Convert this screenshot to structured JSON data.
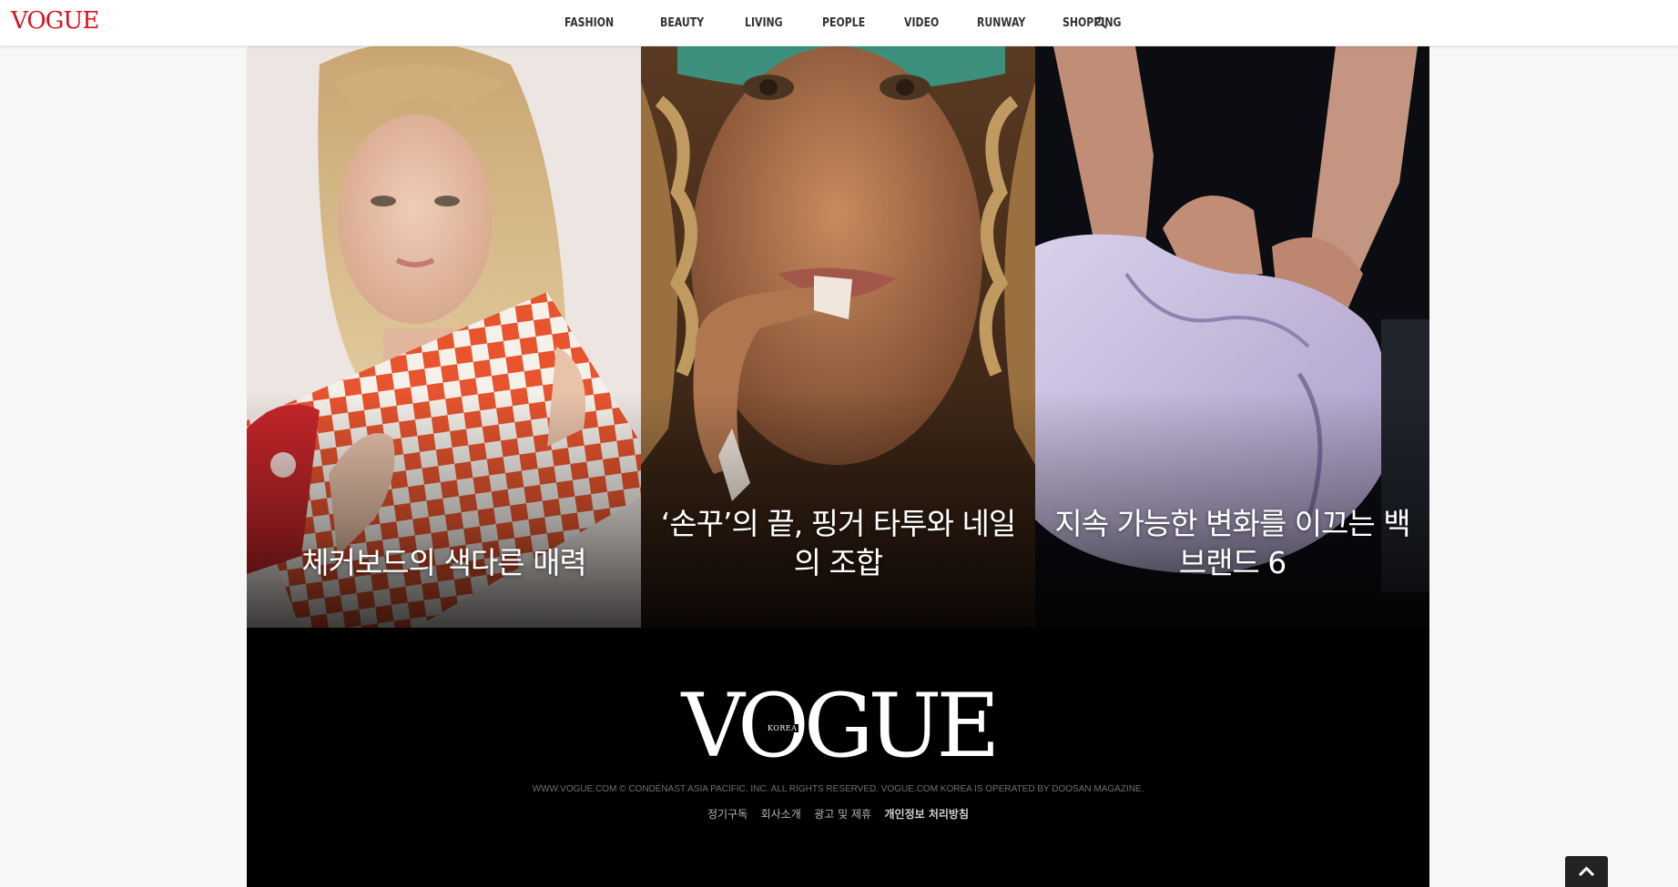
{
  "header": {
    "logo": "VOGUE",
    "nav": [
      "FASHION",
      "BEAUTY",
      "LIVING",
      "PEOPLE",
      "VIDEO",
      "RUNWAY",
      "SHOPPING"
    ],
    "search_icon": "search-icon"
  },
  "cards": [
    {
      "title": "체커보드의 색다른 매력"
    },
    {
      "title": "‘손꾸’의 끝, 핑거 타투와 네일의 조합"
    },
    {
      "title": "지속 가능한 변화를 이끄는 백 브랜드 6"
    }
  ],
  "footer": {
    "logo": "VOGUE",
    "logo_sub": "KOREA",
    "copyright": "WWW.VOGUE.COM © CONDÉNAST ASIA PACIFIC. INC. ALL RIGHTS RESERVED. VOGUE.COM KOREA IS OPERATED BY DOOSAN MAGAZINE.",
    "links": [
      "정기구독",
      "회사소개",
      "광고 및 제휴",
      "개인정보 처리방침"
    ]
  },
  "scroll_top_icon": "chevron-up-icon",
  "colors": {
    "brand_red": "#d6131e",
    "footer_bg": "#000000",
    "page_bg": "#f7f7f7"
  }
}
